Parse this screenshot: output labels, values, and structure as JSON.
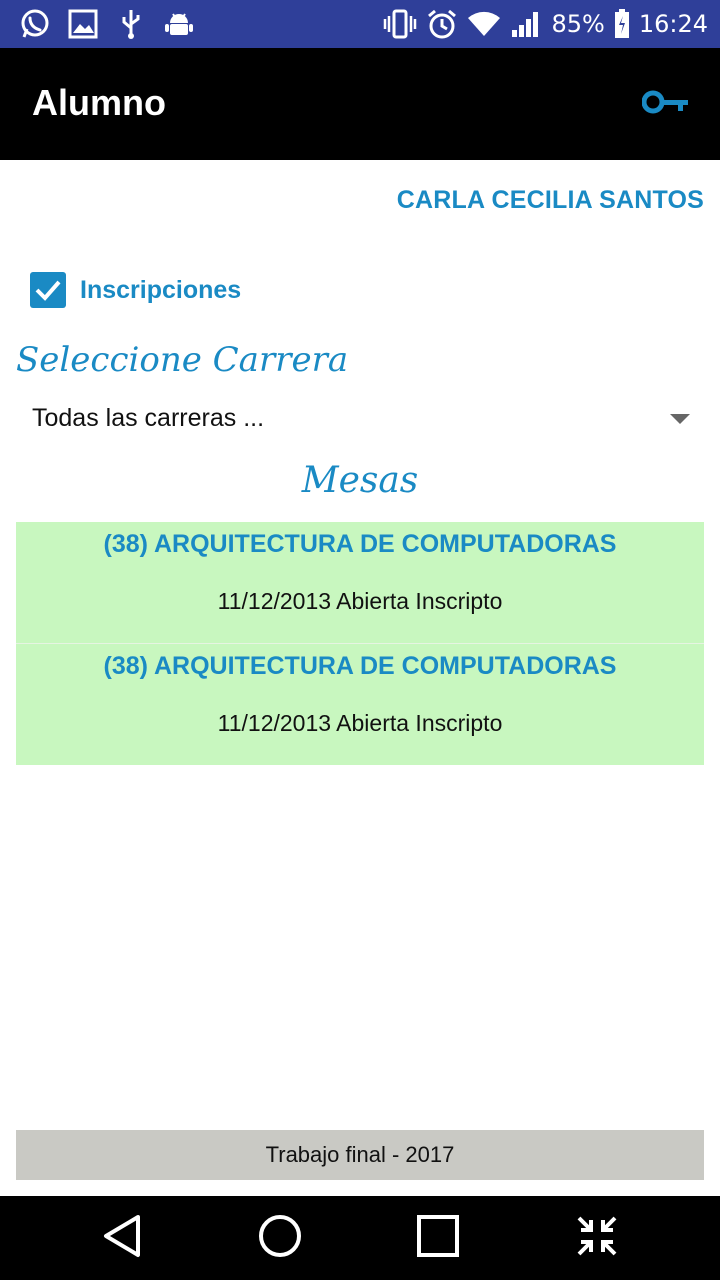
{
  "status_bar": {
    "left_icons": [
      "whatsapp-icon",
      "gallery-icon",
      "usb-icon",
      "android-debug-icon"
    ],
    "right_icons": [
      "vibrate-icon",
      "alarm-icon",
      "wifi-icon",
      "signal-icon",
      "battery-icon"
    ],
    "battery": "85%",
    "time": "16:24",
    "background": "#2f3f99"
  },
  "app_bar": {
    "title": "Alumno",
    "action_icon": "key-icon",
    "accent": "#1a8ac4"
  },
  "user": {
    "name": "CARLA CECILIA SANTOS"
  },
  "inscripciones": {
    "label": "Inscripciones",
    "checked": true
  },
  "carrera": {
    "heading": "Seleccione Carrera",
    "selected": "Todas las carreras ..."
  },
  "mesas": {
    "heading": "Mesas",
    "items": [
      {
        "title": "(38) ARQUITECTURA DE COMPUTADORAS",
        "detail": "11/12/2013 Abierta Inscripto"
      },
      {
        "title": "(38) ARQUITECTURA DE COMPUTADORAS",
        "detail": "11/12/2013 Abierta Inscripto"
      }
    ],
    "background": "#c8f7bf"
  },
  "footer": {
    "text": "Trabajo final - 2017"
  },
  "nav_bar": {
    "buttons": [
      "back-icon",
      "home-icon",
      "recents-icon",
      "collapse-icon"
    ]
  }
}
